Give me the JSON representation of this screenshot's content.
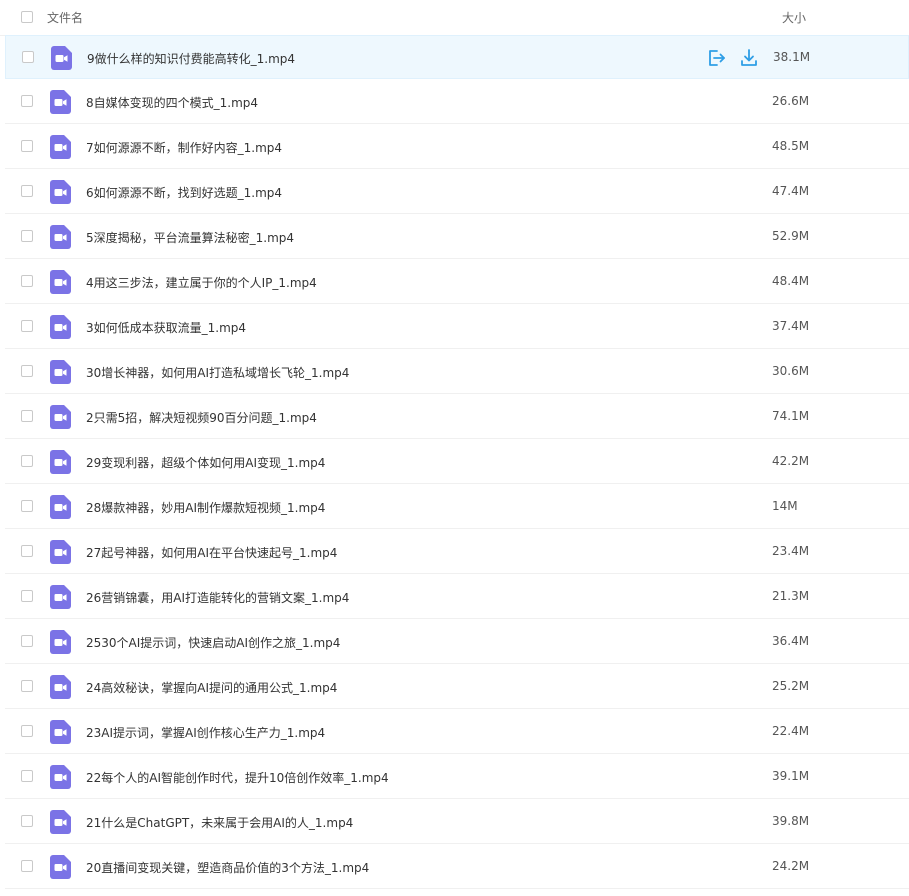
{
  "header": {
    "name_label": "文件名",
    "size_label": "大小"
  },
  "icons": {
    "file": "video-file-icon",
    "share": "share-icon",
    "download": "download-icon"
  },
  "colors": {
    "video_icon": "#7b73e6",
    "action_blue": "#2e9ee6",
    "hover_bg": "#eef8fe"
  },
  "files": [
    {
      "name": "9做什么样的知识付费能高转化_1.mp4",
      "size": "38.1M",
      "hovered": true
    },
    {
      "name": "8自媒体变现的四个模式_1.mp4",
      "size": "26.6M"
    },
    {
      "name": "7如何源源不断，制作好内容_1.mp4",
      "size": "48.5M"
    },
    {
      "name": "6如何源源不断，找到好选题_1.mp4",
      "size": "47.4M"
    },
    {
      "name": "5深度揭秘，平台流量算法秘密_1.mp4",
      "size": "52.9M"
    },
    {
      "name": "4用这三步法，建立属于你的个人IP_1.mp4",
      "size": "48.4M"
    },
    {
      "name": "3如何低成本获取流量_1.mp4",
      "size": "37.4M"
    },
    {
      "name": "30增长神器，如何用AI打造私域增长飞轮_1.mp4",
      "size": "30.6M"
    },
    {
      "name": "2只需5招，解决短视频90百分问题_1.mp4",
      "size": "74.1M"
    },
    {
      "name": "29变现利器，超级个体如何用AI变现_1.mp4",
      "size": "42.2M"
    },
    {
      "name": "28爆款神器，妙用AI制作爆款短视频_1.mp4",
      "size": "14M"
    },
    {
      "name": "27起号神器，如何用AI在平台快速起号_1.mp4",
      "size": "23.4M"
    },
    {
      "name": "26营销锦囊，用AI打造能转化的营销文案_1.mp4",
      "size": "21.3M"
    },
    {
      "name": "2530个AI提示词，快速启动AI创作之旅_1.mp4",
      "size": "36.4M"
    },
    {
      "name": "24高效秘诀，掌握向AI提问的通用公式_1.mp4",
      "size": "25.2M"
    },
    {
      "name": "23AI提示词，掌握AI创作核心生产力_1.mp4",
      "size": "22.4M"
    },
    {
      "name": "22每个人的AI智能创作时代，提升10倍创作效率_1.mp4",
      "size": "39.1M"
    },
    {
      "name": "21什么是ChatGPT，未来属于会用AI的人_1.mp4",
      "size": "39.8M"
    },
    {
      "name": "20直播间变现关键，塑造商品价值的3个方法_1.mp4",
      "size": "24.2M"
    }
  ]
}
